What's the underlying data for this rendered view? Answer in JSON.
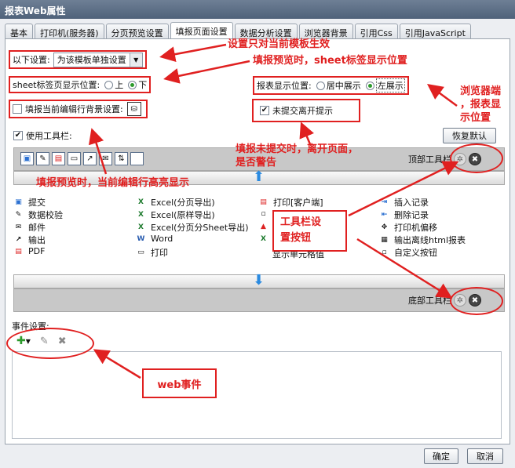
{
  "window": {
    "title": "报表Web属性"
  },
  "tabs": [
    {
      "label": "基本"
    },
    {
      "label": "打印机(服务器)"
    },
    {
      "label": "分页预览设置"
    },
    {
      "label": "填报页面设置",
      "active": true
    },
    {
      "label": "数据分析设置"
    },
    {
      "label": "浏览器背景"
    },
    {
      "label": "引用Css"
    },
    {
      "label": "引用JavaScript"
    }
  ],
  "settings": {
    "scope_label": "以下设置:",
    "scope_value": "为该模板单独设置",
    "sheet_pos_label": "sheet标签页显示位置:",
    "sheet_pos_top": "上",
    "sheet_pos_bottom": "下",
    "sheet_pos_selected": "bottom",
    "report_pos_label": "报表显示位置:",
    "report_pos_center": "居中展示",
    "report_pos_left": "左展示",
    "report_pos_selected": "left",
    "highlight_row_label": "填报当前编辑行背景设置:",
    "highlight_row_checked": false,
    "unsubmitted_label": "未提交离开提示",
    "unsubmitted_checked": true,
    "use_toolbar_label": "使用工具栏:",
    "use_toolbar_checked": true,
    "restore_default": "恢复默认"
  },
  "toolbar": {
    "top_label": "顶部工具栏",
    "bottom_label": "底部工具栏"
  },
  "toolbar_items": {
    "col1": [
      {
        "icon": "save-icon",
        "label": "提交"
      },
      {
        "icon": "validate-icon",
        "label": "数据校验"
      },
      {
        "icon": "mail-icon",
        "label": "邮件"
      },
      {
        "icon": "export-icon",
        "label": "输出"
      },
      {
        "icon": "pdf-icon",
        "label": "PDF"
      }
    ],
    "col2": [
      {
        "icon": "excel-icon",
        "label": "Excel(分页导出)"
      },
      {
        "icon": "excel-icon",
        "label": "Excel(原样导出)"
      },
      {
        "icon": "excel-icon",
        "label": "Excel(分页分Sheet导出)"
      },
      {
        "icon": "word-icon",
        "label": "Word"
      },
      {
        "icon": "print-icon",
        "label": "打印"
      }
    ],
    "col3": [
      {
        "icon": "print-client-icon",
        "label": "打印[客户端]"
      },
      {
        "icon": "blank-icon",
        "label": ""
      },
      {
        "icon": "pdf-icon",
        "label": ""
      },
      {
        "icon": "excel-icon",
        "label": ""
      },
      {
        "icon": "blank-icon",
        "label": "显示单元格值"
      }
    ],
    "col4": [
      {
        "icon": "insert-record-icon",
        "label": "插入记录"
      },
      {
        "icon": "delete-record-icon",
        "label": "删除记录"
      },
      {
        "icon": "move-icon",
        "label": "打印机偏移"
      },
      {
        "icon": "html-report-icon",
        "label": "输出离线html报表"
      },
      {
        "icon": "custom-button-icon",
        "label": "自定义按钮"
      }
    ]
  },
  "events": {
    "label": "事件设置:"
  },
  "footer": {
    "ok": "确定",
    "cancel": "取消"
  },
  "annotations": {
    "scope": "设置只对当前模板生效",
    "sheet": "填报预览时，sheet标签显示位置",
    "browser_line1": "浏览器端",
    "browser_line2": "，报表显",
    "browser_line3": "示位置",
    "unsubmit_line1": "填报未提交时，离开页面，",
    "unsubmit_line2": "是否警告",
    "highlight": "填报预览时，当前编辑行高亮显示",
    "toolbar_set_line1": "工具栏设",
    "toolbar_set_line2": "置按钮",
    "web_event": "web事件"
  },
  "colors": {
    "annotation": "#e02020",
    "accent": "#2a6fd1",
    "title_bar": "#5a6d85"
  }
}
